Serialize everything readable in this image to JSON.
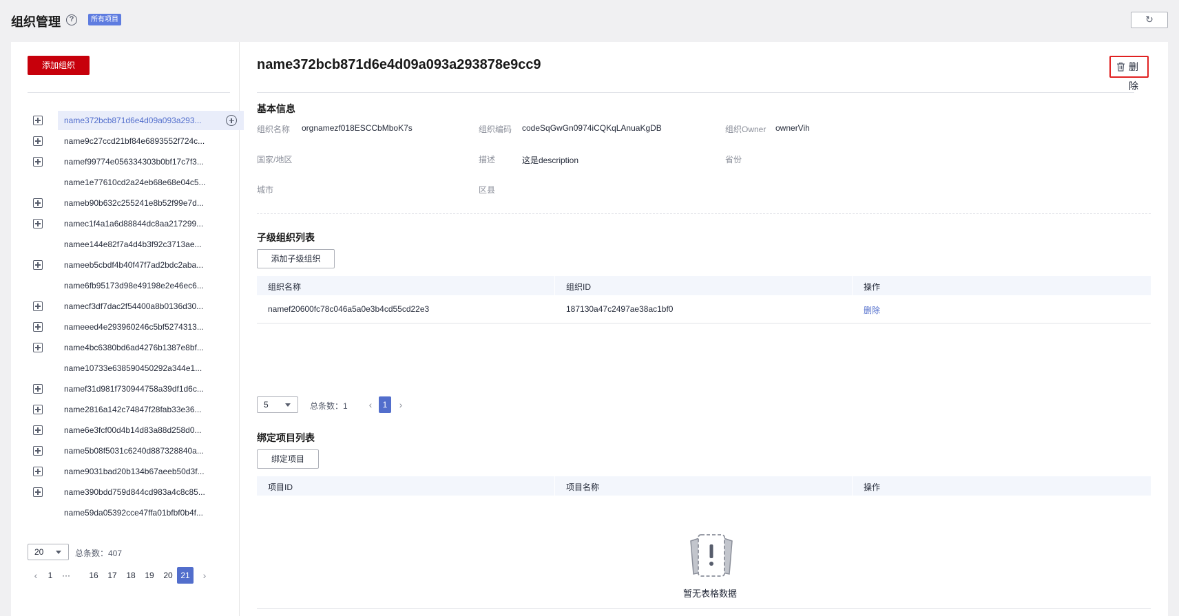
{
  "header": {
    "title": "组织管理",
    "help_icon": "help-circle-icon",
    "badge": "所有项目",
    "refresh_icon": "refresh-icon",
    "refresh_glyph": "↻"
  },
  "left": {
    "add_button": "添加组织",
    "tree": [
      {
        "label": "name372bcb871d6e4d09a093a293...",
        "expandable": true,
        "selected": true
      },
      {
        "label": "name9c27ccd21bf84e6893552f724c...",
        "expandable": true
      },
      {
        "label": "namef99774e056334303b0bf17c7f3...",
        "expandable": true
      },
      {
        "label": "name1e77610cd2a24eb68e68e04c5...",
        "expandable": false
      },
      {
        "label": "nameb90b632c255241e8b52f99e7d...",
        "expandable": true
      },
      {
        "label": "namec1f4a1a6d88844dc8aa217299...",
        "expandable": true
      },
      {
        "label": "namee144e82f7a4d4b3f92c3713ae...",
        "expandable": false
      },
      {
        "label": "nameeb5cbdf4b40f47f7ad2bdc2aba...",
        "expandable": true
      },
      {
        "label": "name6fb95173d98e49198e2e46ec6...",
        "expandable": false
      },
      {
        "label": "namecf3df7dac2f54400a8b0136d30...",
        "expandable": true
      },
      {
        "label": "nameeed4e293960246c5bf5274313...",
        "expandable": true
      },
      {
        "label": "name4bc6380bd6ad4276b1387e8bf...",
        "expandable": true
      },
      {
        "label": "name10733e638590450292a344e1...",
        "expandable": false
      },
      {
        "label": "namef31d981f730944758a39df1d6c...",
        "expandable": true
      },
      {
        "label": "name2816a142c74847f28fab33e36...",
        "expandable": true
      },
      {
        "label": "name6e3fcf00d4b14d83a88d258d0...",
        "expandable": true
      },
      {
        "label": "name5b08f5031c6240d887328840a...",
        "expandable": true
      },
      {
        "label": "name9031bad20b134b67aeeb50d3f...",
        "expandable": true
      },
      {
        "label": "name390bdd759d844cd983a4c8c85...",
        "expandable": true
      },
      {
        "label": "name59da05392cce47ffa01bfbf0b4f...",
        "expandable": false
      }
    ],
    "page_size": "20",
    "total_label": "总条数：407",
    "pager": {
      "prev": "‹",
      "pages": [
        "1",
        "···",
        "16",
        "17",
        "18",
        "19",
        "20",
        "21"
      ],
      "active": "21",
      "next": "›"
    }
  },
  "right": {
    "title": "name372bcb871d6e4d09a093a293878e9cc9",
    "delete_label": "删除",
    "basic_info": {
      "title": "基本信息",
      "fields": {
        "org_name_label": "组织名称",
        "org_name_value": "orgnamezf018ESCCbMboK7s",
        "org_code_label": "组织编码",
        "org_code_value": "codeSqGwGn0974iCQKqLAnuaKgDB",
        "owner_label": "组织Owner",
        "owner_value": "ownerVih",
        "country_label": "国家/地区",
        "country_value": "",
        "desc_label": "描述",
        "desc_value": "这是description",
        "province_label": "省份",
        "province_value": "",
        "city_label": "城市",
        "city_value": "",
        "district_label": "区县",
        "district_value": ""
      }
    },
    "children": {
      "title": "子级组织列表",
      "add_button": "添加子级组织",
      "columns": [
        "组织名称",
        "组织ID",
        "操作"
      ],
      "rows": [
        {
          "name": "namef20600fc78c046a5a0e3b4cd55cd22e3",
          "id": "187130a47c2497ae38ac1bf0",
          "action": "删除"
        }
      ],
      "page_size": "5",
      "total_label": "总条数：1",
      "pager": {
        "prev": "‹",
        "pages": [
          "1"
        ],
        "active": "1",
        "next": "›"
      }
    },
    "projects": {
      "title": "绑定项目列表",
      "bind_button": "绑定项目",
      "columns": [
        "项目ID",
        "项目名称",
        "操作"
      ],
      "empty_text": "暂无表格数据",
      "empty_icon": "empty-table-icon"
    }
  },
  "colors": {
    "primary_red": "#c7000b",
    "link_blue": "#526ecc",
    "badge_blue": "#5e7ce0",
    "delete_highlight": "#e02020"
  }
}
